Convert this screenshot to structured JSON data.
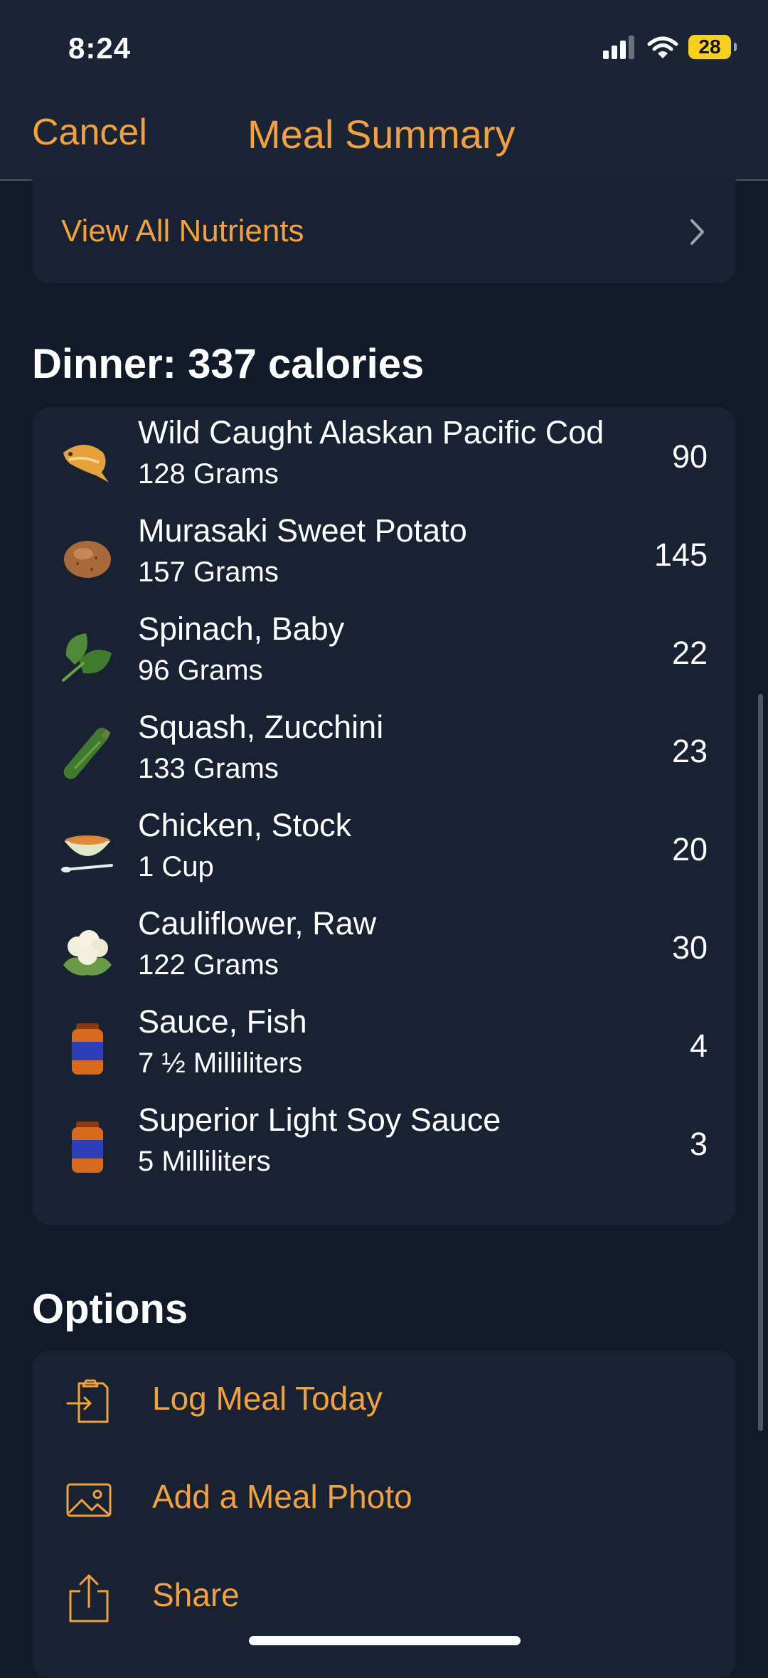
{
  "status_bar": {
    "time": "8:24",
    "battery": "28"
  },
  "nav": {
    "cancel_label": "Cancel",
    "title": "Meal Summary"
  },
  "nutrients_link": {
    "label": "View All Nutrients",
    "icon": "chevron-right-icon"
  },
  "dinner": {
    "title": "Dinner: 337 calories",
    "items": [
      {
        "name": "Wild Caught Alaskan Pacific Cod",
        "amount": "128 Grams",
        "calories": "90",
        "icon": "fish-icon"
      },
      {
        "name": "Murasaki Sweet Potato",
        "amount": "157 Grams",
        "calories": "145",
        "icon": "potato-icon"
      },
      {
        "name": "Spinach, Baby",
        "amount": "96 Grams",
        "calories": "22",
        "icon": "spinach-icon"
      },
      {
        "name": "Squash, Zucchini",
        "amount": "133 Grams",
        "calories": "23",
        "icon": "zucchini-icon"
      },
      {
        "name": "Chicken, Stock",
        "amount": "1 Cup",
        "calories": "20",
        "icon": "soup-bowl-icon"
      },
      {
        "name": "Cauliflower, Raw",
        "amount": "122 Grams",
        "calories": "30",
        "icon": "cauliflower-icon"
      },
      {
        "name": "Sauce, Fish",
        "amount": "7 ½ Milliliters",
        "calories": "4",
        "icon": "sauce-jar-icon"
      },
      {
        "name": "Superior Light Soy Sauce",
        "amount": "5 Milliliters",
        "calories": "3",
        "icon": "sauce-jar-icon"
      }
    ]
  },
  "options": {
    "title": "Options",
    "items": [
      {
        "label": "Log Meal Today",
        "icon": "clipboard-log-icon"
      },
      {
        "label": "Add a Meal Photo",
        "icon": "photo-icon"
      },
      {
        "label": "Share",
        "icon": "share-icon"
      }
    ]
  },
  "colors": {
    "background": "#111a28",
    "card": "#182232",
    "header": "#1a2434",
    "accent": "#f2a23a",
    "battery": "#f7d117"
  }
}
